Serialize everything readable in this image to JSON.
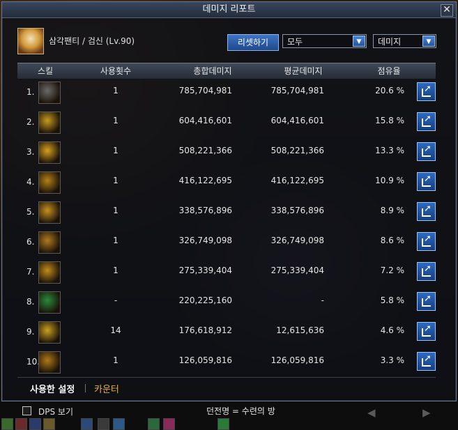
{
  "window": {
    "title": "데미지 리포트",
    "close_icon": "close-icon"
  },
  "character": {
    "label": "삼각팬티 / 검신 (Lv.90)"
  },
  "toolbar": {
    "reset_label": "리셋하기",
    "filter_select": "모두",
    "metric_select": "데미지"
  },
  "table": {
    "headers": [
      "스킬",
      "사용횟수",
      "총합데미지",
      "평균데미지",
      "점유율"
    ],
    "rows": [
      {
        "rank": "1.",
        "count": "1",
        "total": "785,704,981",
        "avg": "785,704,981",
        "share": "20.6 %",
        "icon": "skill-icon-1",
        "color": "#6a6a6a"
      },
      {
        "rank": "2.",
        "count": "1",
        "total": "604,416,601",
        "avg": "604,416,601",
        "share": "15.8 %",
        "icon": "skill-icon-2",
        "color": "#c79a1e"
      },
      {
        "rank": "3.",
        "count": "1",
        "total": "508,221,366",
        "avg": "508,221,366",
        "share": "13.3 %",
        "icon": "skill-icon-3",
        "color": "#d6a020"
      },
      {
        "rank": "4.",
        "count": "1",
        "total": "416,122,695",
        "avg": "416,122,695",
        "share": "10.9 %",
        "icon": "skill-icon-4",
        "color": "#b58018"
      },
      {
        "rank": "5.",
        "count": "1",
        "total": "338,576,896",
        "avg": "338,576,896",
        "share": "8.9 %",
        "icon": "skill-icon-5",
        "color": "#c89020"
      },
      {
        "rank": "6.",
        "count": "1",
        "total": "326,749,098",
        "avg": "326,749,098",
        "share": "8.6 %",
        "icon": "skill-icon-6",
        "color": "#b07a20"
      },
      {
        "rank": "7.",
        "count": "1",
        "total": "275,339,404",
        "avg": "275,339,404",
        "share": "7.2 %",
        "icon": "skill-icon-7",
        "color": "#c48a1c"
      },
      {
        "rank": "8.",
        "count": "-",
        "total": "220,225,160",
        "avg": "-",
        "share": "5.8 %",
        "icon": "skill-icon-8",
        "color": "#2a8a3a"
      },
      {
        "rank": "9.",
        "count": "14",
        "total": "176,618,912",
        "avg": "12,615,636",
        "share": "4.6 %",
        "icon": "skill-icon-9",
        "color": "#c8a020"
      },
      {
        "rank": "10.",
        "count": "1",
        "total": "126,059,816",
        "avg": "126,059,816",
        "share": "3.3 %",
        "icon": "skill-icon-10",
        "color": "#b07818"
      }
    ]
  },
  "tabs": {
    "used_settings": "사용한 설정",
    "counter": "카운터"
  },
  "footer": {
    "dps_label": "DPS 보기",
    "dungeon": "던전명 = 수련의 방"
  }
}
